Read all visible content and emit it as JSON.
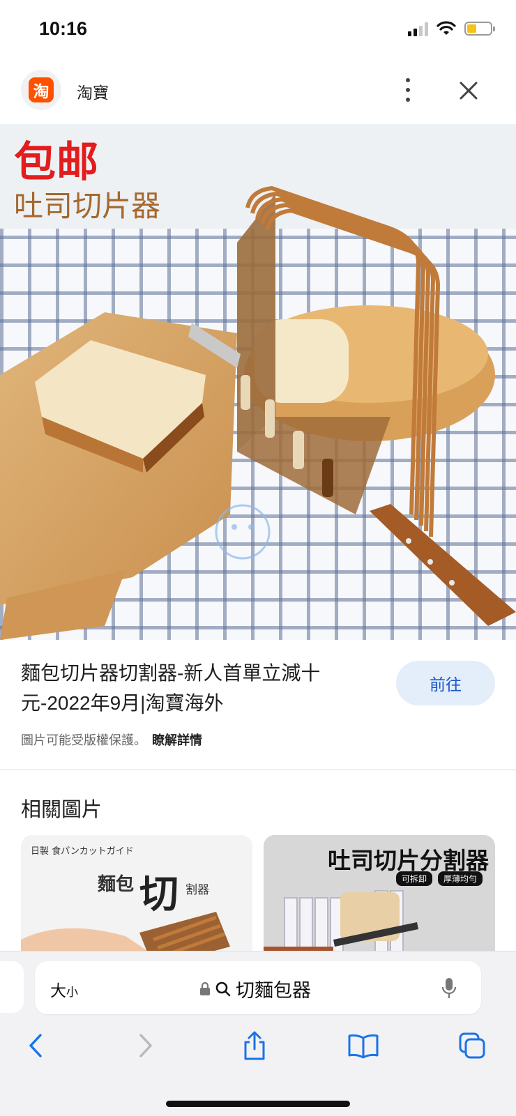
{
  "status_bar": {
    "time": "10:16"
  },
  "site": {
    "logo_char": "淘",
    "name": "淘寶"
  },
  "hero": {
    "promo_text": "包邮",
    "title_text": "吐司切片器"
  },
  "result": {
    "title": "麵包切片器切割器-新人首單立減十元-2022年9月|淘寶海外",
    "visit_label": "前往",
    "copyright_text": "圖片可能受版權保護。",
    "learn_more_label": "瞭解詳情"
  },
  "related": {
    "heading": "相關圖片",
    "thumb1": {
      "jp_text": "日製 食パンカットガイド",
      "main_text": "麵包",
      "big_text": "切",
      "small_text": "割器"
    },
    "thumb2": {
      "title": "吐司切片分割器",
      "tag1": "可拆卸",
      "tag2": "厚薄均勻"
    }
  },
  "address_bar": {
    "text_size_label": "大",
    "text_size_small": "小",
    "query": "切麵包器"
  },
  "colors": {
    "accent": "#1a56c7",
    "visit_bg": "#e4edfa",
    "logo_bg": "#ff5000",
    "promo_red": "#e21d1d"
  },
  "icons": [
    "taobao-logo",
    "more-vert-icon",
    "close-icon",
    "lock-icon",
    "search-icon",
    "mic-icon",
    "back-icon",
    "forward-icon",
    "share-icon",
    "bookmarks-icon",
    "tabs-icon"
  ]
}
